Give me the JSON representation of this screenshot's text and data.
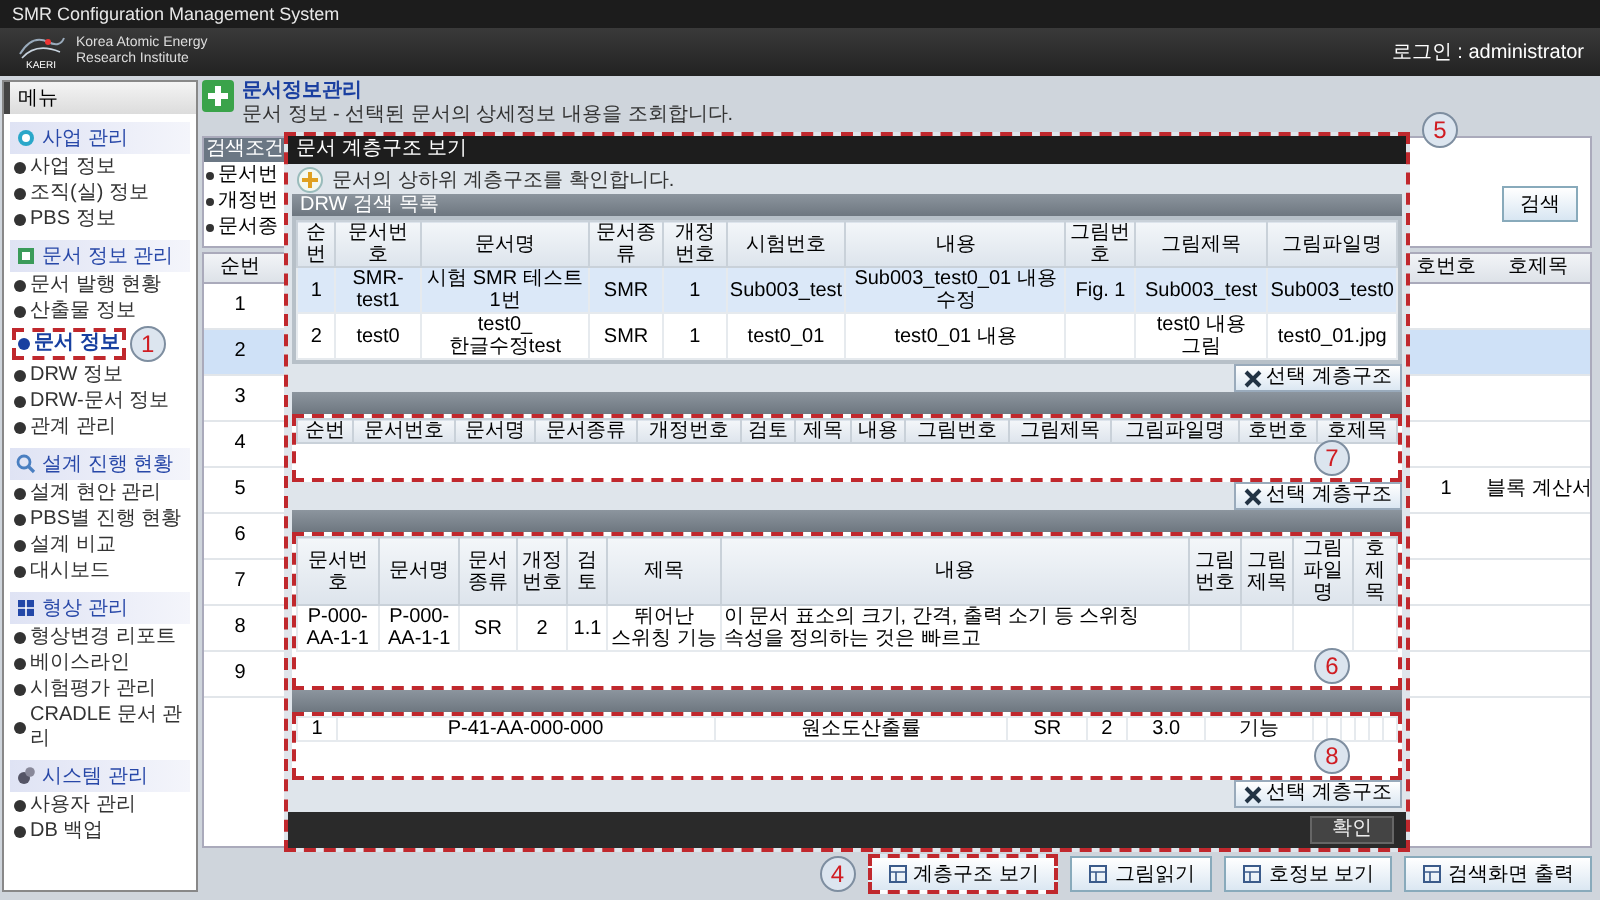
{
  "window": {
    "title": "SMR Configuration Management System"
  },
  "header": {
    "logo_text": "KAERI",
    "org_line1": "Korea Atomic Energy",
    "org_line2": "Research Institute",
    "login": "로그인 : administrator"
  },
  "sidebar": {
    "title": "메뉴",
    "groups": [
      {
        "label": "사업 관리",
        "items": [
          {
            "label": "사업 정보",
            "selected": false
          },
          {
            "label": "조직(실) 정보",
            "selected": false
          },
          {
            "label": "PBS 정보",
            "selected": false
          }
        ]
      },
      {
        "label": "문서 정보 관리",
        "items": [
          {
            "label": "문서 발행 현황",
            "selected": false
          },
          {
            "label": "산출물 정보",
            "selected": false
          },
          {
            "label": "문서 정보",
            "selected": true,
            "callout": "1"
          },
          {
            "label": "DRW 정보",
            "selected": false
          },
          {
            "label": "DRW-문서 정보",
            "selected": false
          },
          {
            "label": "관계 관리",
            "selected": false
          }
        ]
      },
      {
        "label": "설계 진행 현황",
        "items": [
          {
            "label": "설계 현안 관리",
            "selected": false
          },
          {
            "label": "PBS별 진행 현황",
            "selected": false
          },
          {
            "label": "설계 비교",
            "selected": false
          },
          {
            "label": "대시보드",
            "selected": false
          }
        ]
      },
      {
        "label": "형상 관리",
        "items": [
          {
            "label": "형상변경 리포트",
            "selected": false
          },
          {
            "label": "베이스라인",
            "selected": false
          },
          {
            "label": "시험평가 관리",
            "selected": false
          },
          {
            "label": "CRADLE 문서 관리",
            "selected": false
          }
        ]
      },
      {
        "label": "시스템 관리",
        "items": [
          {
            "label": "사용자 관리",
            "selected": false
          },
          {
            "label": "DB 백업",
            "selected": false
          }
        ]
      }
    ]
  },
  "page": {
    "title": "문서정보관리",
    "subtitle": "문서 정보 - 선택된 문서의 상세정보 내용을 조회합니다."
  },
  "search": {
    "title": "검색조건",
    "fields": [
      "문서번",
      "개정번",
      "문서종"
    ],
    "button": "검색"
  },
  "table": {
    "columns": [
      "순번",
      "호번호",
      "호제목"
    ],
    "rows": [
      {
        "no": "1",
        "selected": false
      },
      {
        "no": "2",
        "selected": true
      },
      {
        "no": "3",
        "selected": false
      },
      {
        "no": "4",
        "selected": false
      },
      {
        "no": "5",
        "number": "1",
        "title": "블록 계산서",
        "selected": false
      },
      {
        "no": "6",
        "selected": false
      },
      {
        "no": "7",
        "selected": false
      },
      {
        "no": "8",
        "selected": false
      },
      {
        "no": "9",
        "selected": false
      }
    ]
  },
  "buttons": [
    {
      "label": "계층구조 보기",
      "callout": "4"
    },
    {
      "label": "그림읽기"
    },
    {
      "label": "호정보 보기"
    },
    {
      "label": "검색화면 출력"
    }
  ],
  "dialog": {
    "title": "문서 계층구조 보기",
    "callout": "5",
    "info": "문서의 상하위 계층구조를 확인합니다.",
    "ok_button": "확인",
    "sections": [
      {
        "title": "DRW 검색 목록",
        "columns": [
          "순번",
          "문서번호",
          "문서명",
          "문서종류",
          "개정번호",
          "시험번호",
          "내용",
          "그림번호",
          "그림제목",
          "그림파일명"
        ],
        "rows": [
          {
            "cells": [
              "1",
              "SMR-test1",
              "시험 SMR 테스트 1번",
              "SMR",
              "1",
              "Sub003_test",
              "Sub003_test0_01 내용 수정",
              "Fig. 1",
              "Sub003_test",
              "Sub003_test0"
            ],
            "selected": true
          },
          {
            "cells": [
              "2",
              "test0",
              "test0_한글수정test",
              "SMR",
              "1",
              "test0_01",
              "test0_01 내용",
              "",
              "test0 내용 그림",
              "test0_01.jpg"
            ],
            "selected": false
          }
        ],
        "button": "선택 계층구조"
      },
      {
        "columns": [
          "순번",
          "문서번호",
          "문서명",
          "문서종류",
          "개정번호",
          "검토",
          "제목",
          "내용",
          "그림번호",
          "그림제목",
          "그림파일명",
          "호번호",
          "호제목"
        ],
        "button": "선택 계층구조",
        "callout": "7"
      },
      {
        "columns": [
          "문서번호",
          "문서명",
          "문서종류",
          "개정번호",
          "검토",
          "제목",
          "내용",
          "그림번호",
          "그림제목",
          "그림파일명",
          "호제목"
        ],
        "rows": [
          {
            "cells": [
              "P-000-AA-1-1",
              "P-000-AA-1-1",
              "SR",
              "2",
              "1.1",
              "뛰어난 스위칭 기능",
              "이 문서 표소의 크기, 간격, 출력 소기 등 스위칭 속성을 정의하는 것은 빠르고"
            ],
            "selected": false
          }
        ],
        "callout": "6"
      },
      {
        "rows": [
          {
            "cells": [
              "1",
              "P-41-AA-000-000",
              "원소도산출률",
              "SR",
              "2",
              "3.0",
              "기능"
            ],
            "selected": false
          }
        ],
        "button": "선택 계층구조",
        "callout": "8"
      }
    ]
  }
}
